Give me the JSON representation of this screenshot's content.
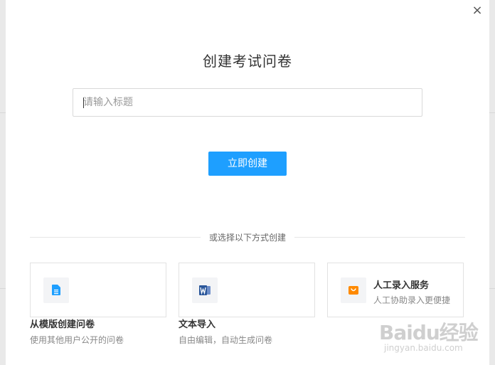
{
  "modal": {
    "close_glyph": "×",
    "title": "创建考试问卷",
    "title_input": {
      "placeholder": "请输入标题",
      "value": ""
    },
    "create_button": "立即创建",
    "divider_text": "或选择以下方式创建"
  },
  "options": [
    {
      "icon": "document-icon",
      "label": "从模版创建问卷",
      "description": "使用其他用户公开的问卷"
    },
    {
      "icon": "word-icon",
      "label": "文本导入",
      "description": "自由编辑，自动生成问卷"
    },
    {
      "icon": "shop-icon",
      "label": "人工录入服务",
      "description": "人工协助录入更便捷"
    }
  ],
  "watermark": {
    "brand": "Baidu经验",
    "url": "jingyan.baidu.com"
  },
  "colors": {
    "primary": "#1e9fff",
    "word_icon": "#2b579a",
    "shop_icon": "#ff8a00"
  }
}
